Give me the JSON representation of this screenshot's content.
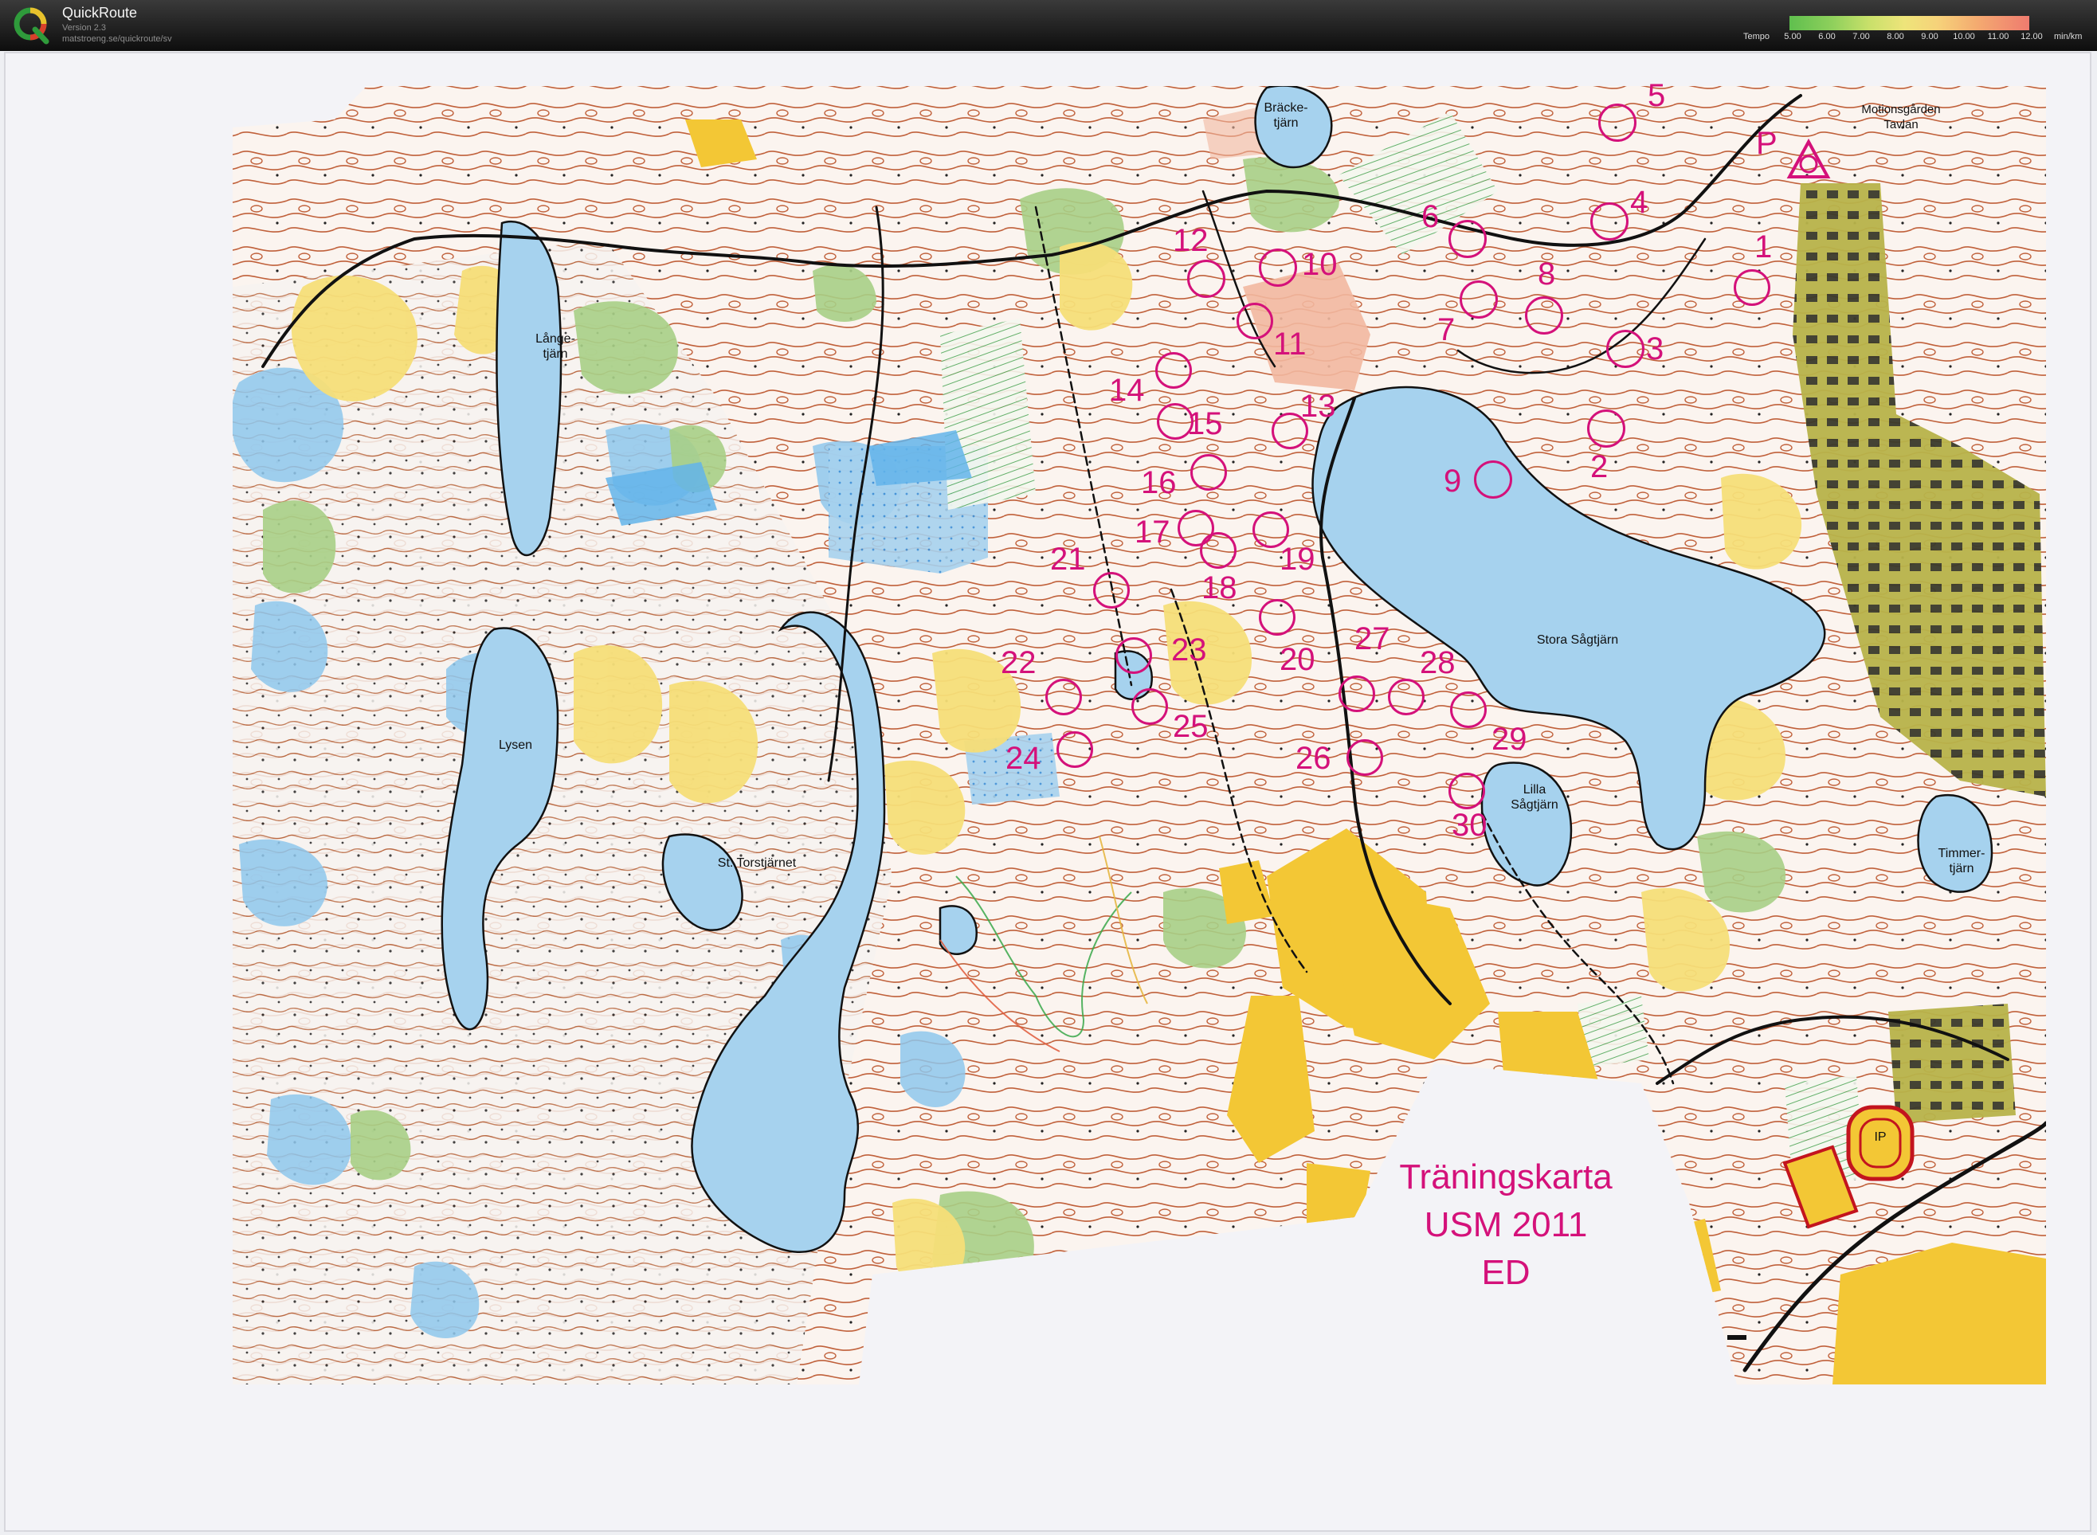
{
  "app": {
    "name": "QuickRoute",
    "version": "Version 2.3",
    "url": "matstroeng.se/quickroute/sv"
  },
  "legend": {
    "title": "Tempo",
    "ticks": [
      "5.00",
      "6.00",
      "7.00",
      "8.00",
      "9.00",
      "10.00",
      "11.00",
      "12.00"
    ],
    "unit": "min/km"
  },
  "map": {
    "title_lines": [
      "Träningskarta",
      "USM 2011",
      "ED"
    ],
    "place_names": {
      "brackjarn": "Bräcke-\ntjärn",
      "motionsgarden": "Motionsgården\nTavlan",
      "langetjarn": "Långe-\ntjärn",
      "lysen": "Lysen",
      "torstjarnet": "St. Torstjärnet",
      "stora_sagtjarn": "Stora Sågtjärn",
      "lilla_sagtjarn": "Lilla\nSågtjärn",
      "timmertjarn": "Timmer-\ntjärn",
      "ip": "IP",
      "parking": "P"
    },
    "controls": [
      "1",
      "2",
      "3",
      "4",
      "5",
      "6",
      "7",
      "8",
      "9",
      "10",
      "11",
      "12",
      "13",
      "14",
      "15",
      "16",
      "17",
      "18",
      "19",
      "20",
      "21",
      "22",
      "23",
      "24",
      "25",
      "26",
      "27",
      "28",
      "29",
      "30"
    ]
  },
  "colors": {
    "water": "#a9d3ef",
    "water_dark": "#7cc0ea",
    "forest_open": "#f7e07a",
    "field": "#f3c735",
    "green": "#9dc97a",
    "contour": "#b3542e",
    "control": "#d4117a",
    "rough": "#fbeec0"
  }
}
